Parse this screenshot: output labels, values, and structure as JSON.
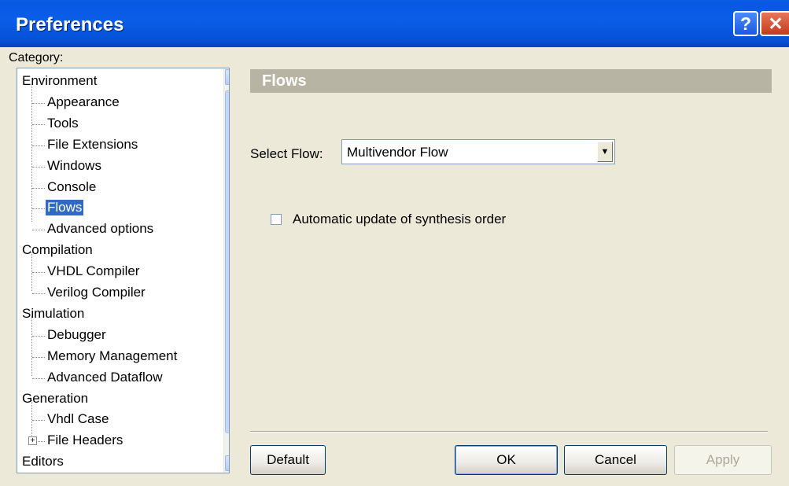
{
  "window": {
    "title": "Preferences"
  },
  "title_buttons": {
    "help_icon": "?",
    "close_icon": "✕"
  },
  "category_label": "Category:",
  "tree": {
    "items": [
      {
        "label": "Environment",
        "level": 0
      },
      {
        "label": "Appearance",
        "level": 1
      },
      {
        "label": "Tools",
        "level": 1
      },
      {
        "label": "File Extensions",
        "level": 1
      },
      {
        "label": "Windows",
        "level": 1
      },
      {
        "label": "Console",
        "level": 1
      },
      {
        "label": "Flows",
        "level": 1,
        "selected": true
      },
      {
        "label": "Advanced options",
        "level": 1
      },
      {
        "label": "Compilation",
        "level": 0
      },
      {
        "label": "VHDL Compiler",
        "level": 1
      },
      {
        "label": "Verilog Compiler",
        "level": 1
      },
      {
        "label": "Simulation",
        "level": 0
      },
      {
        "label": "Debugger",
        "level": 1
      },
      {
        "label": "Memory Management",
        "level": 1
      },
      {
        "label": "Advanced Dataflow",
        "level": 1
      },
      {
        "label": "Generation",
        "level": 0
      },
      {
        "label": "Vhdl Case",
        "level": 1
      },
      {
        "label": "File Headers",
        "level": 1,
        "expander": "+"
      },
      {
        "label": "Editors",
        "level": 0
      }
    ],
    "scroll_up_icon": "▲",
    "scroll_down_icon": "▼"
  },
  "panel": {
    "header": "Flows",
    "select_label": "Select Flow:",
    "select_value": "Multivendor Flow",
    "dropdown_icon": "▼",
    "checkbox_label": "Automatic update of synthesis order",
    "checkbox_checked": false
  },
  "buttons": {
    "default": "Default",
    "ok": "OK",
    "cancel": "Cancel",
    "apply": "Apply"
  },
  "colors": {
    "title_bar": "#0757e2",
    "selection": "#316ac5",
    "header_bar": "#b7b4a4",
    "dialog_bg": "#ece9d8"
  }
}
